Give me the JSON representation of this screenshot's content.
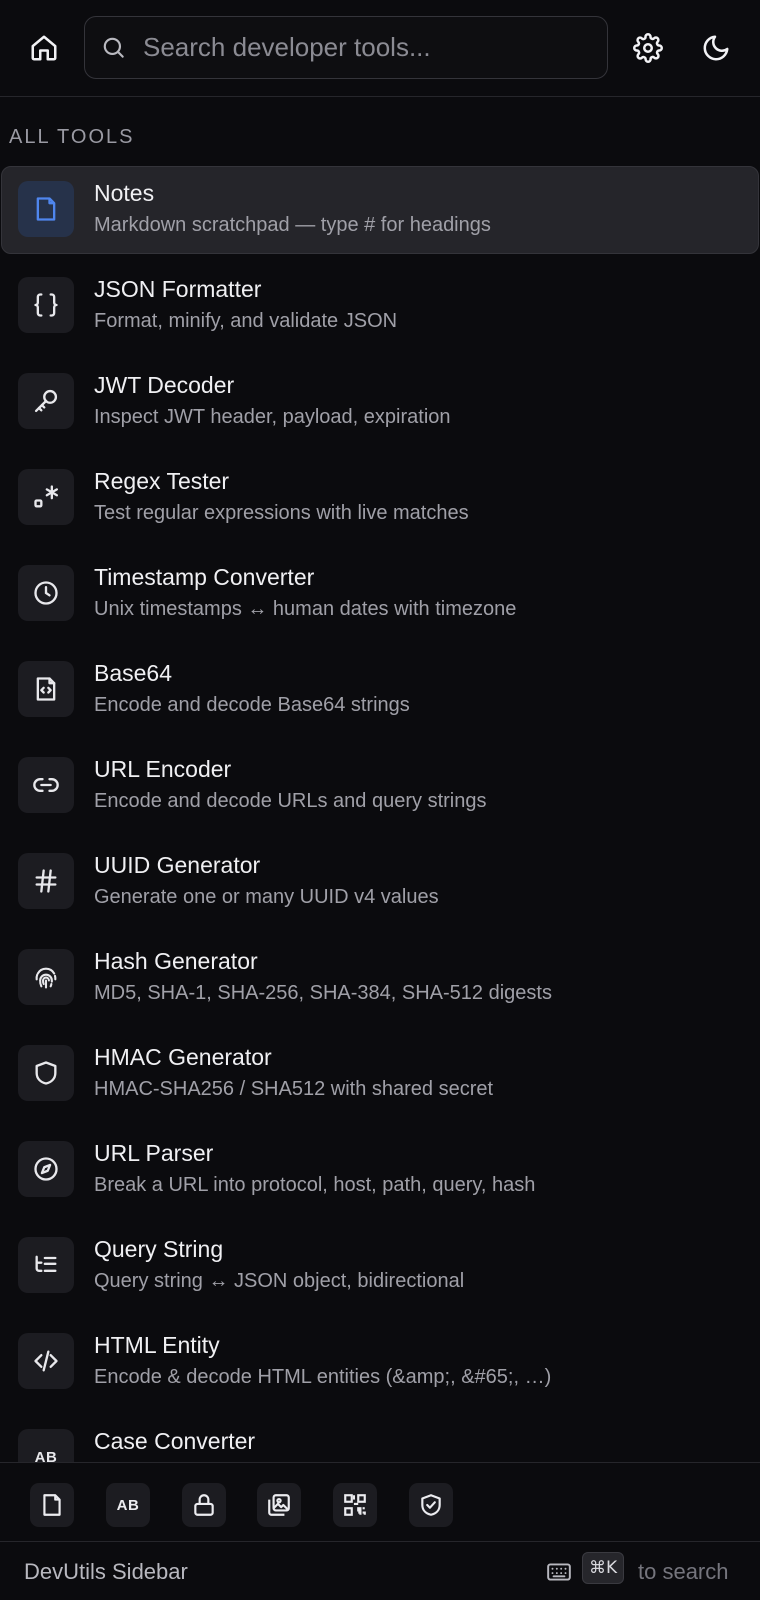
{
  "header": {
    "home_icon": "home-icon",
    "search_placeholder": "Search developer tools...",
    "search_value": "",
    "settings_icon": "gear-icon",
    "theme_icon": "moon-icon"
  },
  "section_title": "ALL TOOLS",
  "tools": [
    {
      "name": "Notes",
      "desc": "Markdown scratchpad — type # for headings",
      "icon": "file-icon",
      "active": true
    },
    {
      "name": "JSON Formatter",
      "desc": "Format, minify, and validate JSON",
      "icon": "braces-icon"
    },
    {
      "name": "JWT Decoder",
      "desc": "Inspect JWT header, payload, expiration",
      "icon": "key-icon"
    },
    {
      "name": "Regex Tester",
      "desc": "Test regular expressions with live matches",
      "icon": "regex-icon"
    },
    {
      "name": "Timestamp Converter",
      "desc": "Unix timestamps ↔ human dates with timezone",
      "icon": "clock-icon"
    },
    {
      "name": "Base64",
      "desc": "Encode and decode Base64 strings",
      "icon": "file-code-icon"
    },
    {
      "name": "URL Encoder",
      "desc": "Encode and decode URLs and query strings",
      "icon": "link-icon"
    },
    {
      "name": "UUID Generator",
      "desc": "Generate one or many UUID v4 values",
      "icon": "hash-icon"
    },
    {
      "name": "Hash Generator",
      "desc": "MD5, SHA-1, SHA-256, SHA-384, SHA-512 digests",
      "icon": "fingerprint-icon"
    },
    {
      "name": "HMAC Generator",
      "desc": "HMAC-SHA256 / SHA512 with shared secret",
      "icon": "shield-icon"
    },
    {
      "name": "URL Parser",
      "desc": "Break a URL into protocol, host, path, query, hash",
      "icon": "compass-icon"
    },
    {
      "name": "Query String",
      "desc": "Query string ↔ JSON object, bidirectional",
      "icon": "list-tree-icon"
    },
    {
      "name": "HTML Entity",
      "desc": "Encode & decode HTML entities (&amp;, &#65;, …)",
      "icon": "code-icon"
    },
    {
      "name": "Case Converter",
      "desc": "",
      "icon": "case-icon",
      "icon_text": "AB"
    }
  ],
  "pinned": [
    {
      "icon": "file-icon"
    },
    {
      "icon": "case-icon",
      "text": "AB"
    },
    {
      "icon": "lock-icon"
    },
    {
      "icon": "image-icon"
    },
    {
      "icon": "qr-code-icon"
    },
    {
      "icon": "shield-check-icon"
    }
  ],
  "footer": {
    "title": "DevUtils Sidebar",
    "keyboard_icon": "keyboard-icon",
    "shortcut": "⌘K",
    "hint": "to search"
  }
}
